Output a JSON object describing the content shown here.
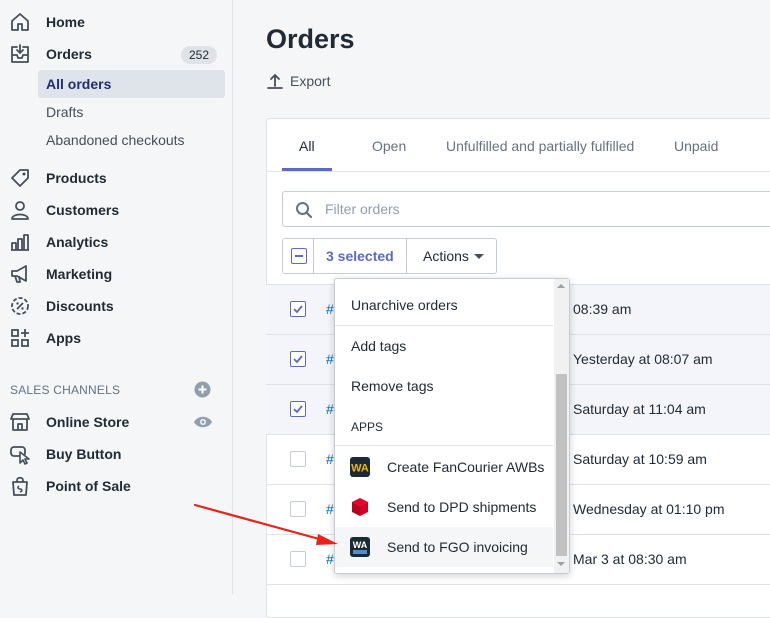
{
  "sidebar": {
    "nav": [
      {
        "label": "Home",
        "icon": "home-icon"
      },
      {
        "label": "Orders",
        "icon": "orders-icon",
        "badge": "252"
      }
    ],
    "orders_sub": [
      "All orders",
      "Drafts",
      "Abandoned checkouts"
    ],
    "nav2": [
      {
        "label": "Products",
        "icon": "tag-icon"
      },
      {
        "label": "Customers",
        "icon": "person-icon"
      },
      {
        "label": "Analytics",
        "icon": "bar-chart-icon"
      },
      {
        "label": "Marketing",
        "icon": "megaphone-icon"
      },
      {
        "label": "Discounts",
        "icon": "discount-icon"
      },
      {
        "label": "Apps",
        "icon": "apps-icon"
      }
    ],
    "channels_header": "SALES CHANNELS",
    "channels": [
      {
        "label": "Online Store",
        "icon": "store-icon"
      },
      {
        "label": "Buy Button",
        "icon": "buy-button-icon"
      },
      {
        "label": "Point of Sale",
        "icon": "shopping-bag-icon"
      }
    ]
  },
  "main": {
    "title": "Orders",
    "export_label": "Export",
    "tabs": [
      "All",
      "Open",
      "Unfulfilled and partially fulfilled",
      "Unpaid"
    ],
    "filter_placeholder": "Filter orders",
    "selected_label": "3 selected",
    "actions_label": "Actions",
    "rows": [
      {
        "num": "#",
        "date": "08:39 am",
        "selected": true
      },
      {
        "num": "#",
        "date": "Yesterday at 08:07 am",
        "selected": true
      },
      {
        "num": "#",
        "date": "Saturday at 11:04 am",
        "selected": true
      },
      {
        "num": "#",
        "date": "Saturday at 10:59 am",
        "selected": false
      },
      {
        "num": "#",
        "date": "Wednesday at 01:10 pm",
        "selected": false
      },
      {
        "num": "#",
        "date": "Mar 3 at 08:30 am",
        "selected": false
      }
    ]
  },
  "dropdown": {
    "items": [
      "Unarchive orders",
      "Add tags",
      "Remove tags"
    ],
    "apps_header": "APPS",
    "apps": [
      {
        "label": "Create FanCourier AWBs",
        "icon": "wa-app-icon"
      },
      {
        "label": "Send to DPD shipments",
        "icon": "dpd-cube-icon"
      },
      {
        "label": "Send to FGO invoicing",
        "icon": "wa-fgo-app-icon"
      }
    ]
  },
  "colors": {
    "accent": "#5c6ac4",
    "link": "#006fbb",
    "annotation_arrow": "#e8231c"
  }
}
